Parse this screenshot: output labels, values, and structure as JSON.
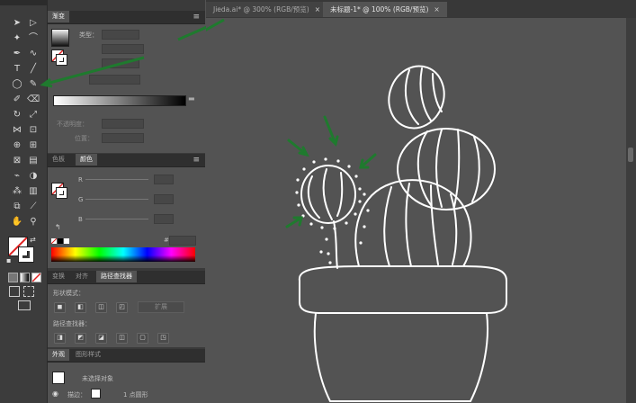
{
  "document_tabs": [
    {
      "label": "Jieda.ai* @ 300% (RGB/预览)",
      "active": false,
      "close": "×"
    },
    {
      "label": "未标题-1* @ 100% (RGB/预览)",
      "active": true,
      "close": "×"
    }
  ],
  "gradient_panel": {
    "tab_label": "渐变",
    "type_label": "类型：",
    "opacity_label": "不透明度：",
    "location_label": "位置："
  },
  "color_panel": {
    "tabs": [
      "色板",
      "颜色"
    ],
    "channels": [
      "R",
      "G",
      "B"
    ],
    "hex_prefix": "#"
  },
  "pathfinder_panel": {
    "tabs": [
      "变换",
      "对齐",
      "路径查找器"
    ],
    "shape_modes_label": "形状模式：",
    "expand_label": "扩展",
    "pathfinders_label": "路径查找器："
  },
  "appearance_panel": {
    "tabs": [
      "外观",
      "图形样式"
    ],
    "object_label": "未选择对象",
    "stroke_label": "描边：",
    "stroke_value": "1 点圆形"
  },
  "colors": {
    "toolbar_bg": "#3c3c3c",
    "panel_bg": "#535353",
    "canvas_bg": "#535353",
    "artwork_stroke": "#ffffff",
    "annotation_arrow": "#1f7a2e",
    "none_swatch_red": "#e02020"
  },
  "tool_icons": [
    "selection-tool-icon",
    "direct-selection-tool-icon",
    "magic-wand-icon",
    "lasso-icon",
    "pen-tool-icon",
    "curvature-tool-icon",
    "type-tool-icon",
    "line-tool-icon",
    "ellipse-tool-icon",
    "paintbrush-tool-icon",
    "shaper-tool-icon",
    "eraser-tool-icon",
    "rotate-tool-icon",
    "scale-tool-icon",
    "width-tool-icon",
    "free-transform-icon",
    "shape-builder-icon",
    "perspective-grid-icon",
    "mesh-tool-icon",
    "gradient-tool-icon",
    "eyedropper-tool-icon",
    "blend-tool-icon",
    "symbol-sprayer-icon",
    "column-graph-icon",
    "artboard-tool-icon",
    "slice-tool-icon",
    "hand-tool-icon",
    "zoom-tool-icon"
  ]
}
